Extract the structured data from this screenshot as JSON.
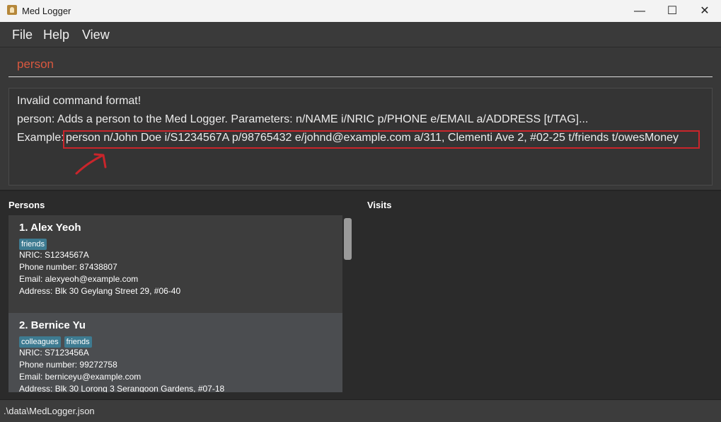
{
  "window": {
    "title": "Med Logger",
    "minimize": "—",
    "maximize": "☐",
    "close": "✕"
  },
  "menu": {
    "file": "File",
    "help": "Help",
    "view": "View"
  },
  "command_box": {
    "value": "person"
  },
  "result": {
    "line1": "Invalid command format!",
    "line2": "person: Adds a person to the Med Logger. Parameters: n/NAME i/NRIC p/PHONE e/EMAIL a/ADDRESS [t/TAG]...",
    "example_label": "Example:",
    "example_command": "person n/John Doe i/S1234567A p/98765432 e/johnd@example.com a/311, Clementi Ave 2, #02-25 t/friends t/owesMoney"
  },
  "colors": {
    "highlight": "#c9252b",
    "tag": "#3e7b91",
    "command_text": "#d9583f"
  },
  "persons_label": "Persons",
  "visits_label": "Visits",
  "persons": [
    {
      "title": "1. Alex Yeoh",
      "tags": [
        "friends"
      ],
      "nric": "NRIC: S1234567A",
      "phone": "Phone number: 87438807",
      "email": "Email: alexyeoh@example.com",
      "address": "Address: Blk 30 Geylang Street 29, #06-40"
    },
    {
      "title": "2. Bernice Yu",
      "tags": [
        "colleagues",
        "friends"
      ],
      "nric": "NRIC: S7123456A",
      "phone": "Phone number: 99272758",
      "email": "Email: berniceyu@example.com",
      "address": "Address: Blk 30 Lorong 3 Serangoon Gardens, #07-18"
    }
  ],
  "status": {
    "path": ".\\data\\MedLogger.json"
  }
}
